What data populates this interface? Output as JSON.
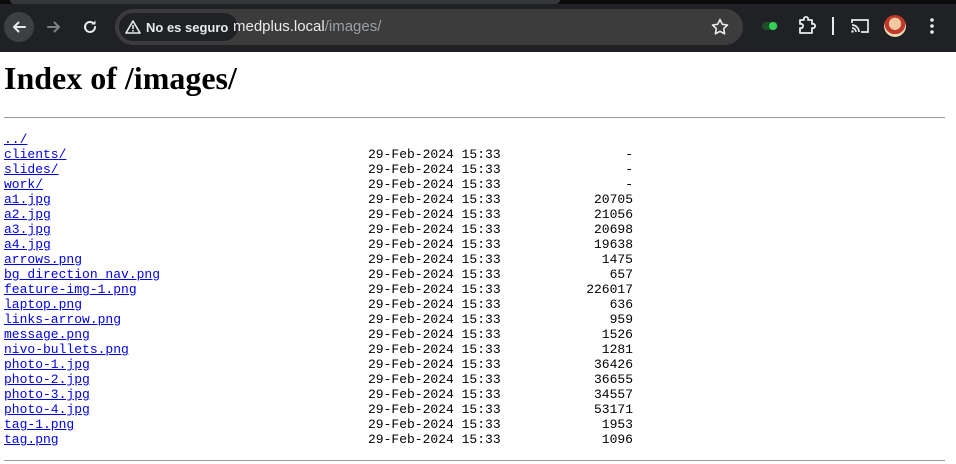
{
  "browser": {
    "security_label": "No es seguro",
    "url_host": "medplus.local",
    "url_path": "/images/",
    "icons": [
      "back-arrow-icon",
      "forward-arrow-icon",
      "reload-icon",
      "warning-triangle-icon",
      "star-icon",
      "extension-toggle-icon",
      "puzzle-icon",
      "cast-icon",
      "avatar",
      "kebab-menu-icon"
    ]
  },
  "page": {
    "title": "Index of /images/",
    "parent_link": "../",
    "entries": [
      {
        "name": "clients/",
        "date": "29-Feb-2024 15:33",
        "size": "-"
      },
      {
        "name": "slides/",
        "date": "29-Feb-2024 15:33",
        "size": "-"
      },
      {
        "name": "work/",
        "date": "29-Feb-2024 15:33",
        "size": "-"
      },
      {
        "name": "a1.jpg",
        "date": "29-Feb-2024 15:33",
        "size": "20705"
      },
      {
        "name": "a2.jpg",
        "date": "29-Feb-2024 15:33",
        "size": "21056"
      },
      {
        "name": "a3.jpg",
        "date": "29-Feb-2024 15:33",
        "size": "20698"
      },
      {
        "name": "a4.jpg",
        "date": "29-Feb-2024 15:33",
        "size": "19638"
      },
      {
        "name": "arrows.png",
        "date": "29-Feb-2024 15:33",
        "size": "1475"
      },
      {
        "name": "bg_direction_nav.png",
        "date": "29-Feb-2024 15:33",
        "size": "657"
      },
      {
        "name": "feature-img-1.png",
        "date": "29-Feb-2024 15:33",
        "size": "226017"
      },
      {
        "name": "laptop.png",
        "date": "29-Feb-2024 15:33",
        "size": "636"
      },
      {
        "name": "links-arrow.png",
        "date": "29-Feb-2024 15:33",
        "size": "959"
      },
      {
        "name": "message.png",
        "date": "29-Feb-2024 15:33",
        "size": "1526"
      },
      {
        "name": "nivo-bullets.png",
        "date": "29-Feb-2024 15:33",
        "size": "1281"
      },
      {
        "name": "photo-1.jpg",
        "date": "29-Feb-2024 15:33",
        "size": "36426"
      },
      {
        "name": "photo-2.jpg",
        "date": "29-Feb-2024 15:33",
        "size": "36655"
      },
      {
        "name": "photo-3.jpg",
        "date": "29-Feb-2024 15:33",
        "size": "34557"
      },
      {
        "name": "photo-4.jpg",
        "date": "29-Feb-2024 15:33",
        "size": "53171"
      },
      {
        "name": "tag-1.png",
        "date": "29-Feb-2024 15:33",
        "size": "1953"
      },
      {
        "name": "tag.png",
        "date": "29-Feb-2024 15:33",
        "size": "1096"
      }
    ]
  },
  "colors": {
    "toolbar_bg": "#202124",
    "omnibox_bg": "#3c3c3c",
    "link": "#0000ee",
    "extension_green": "#34d058"
  }
}
